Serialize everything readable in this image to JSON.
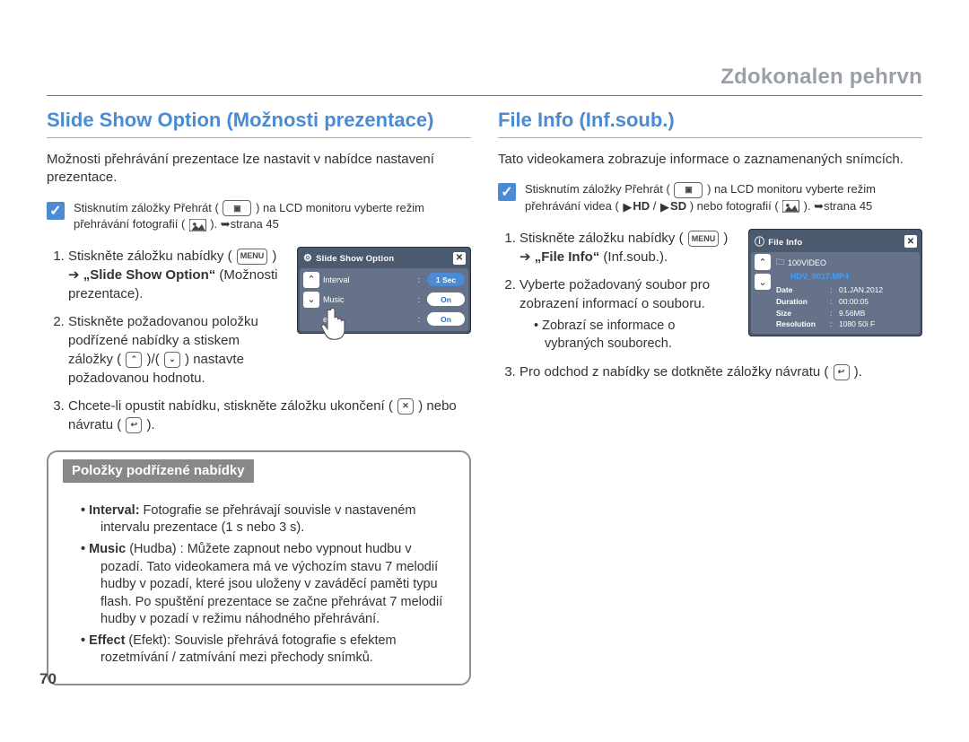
{
  "header": "Zdokonalen pehrvn",
  "page_number": "70",
  "left": {
    "title": "Slide Show Option (Možnosti prezentace)",
    "intro": "Možnosti přehrávání prezentace lze nastavit v nabídce nastavení prezentace.",
    "note_prefix": "Stisknutím záložky Přehrát (",
    "note_mid": ") na LCD monitoru vyberte režim přehrávání fotografií (",
    "note_suffix": "). ➥strana 45",
    "steps": {
      "s1a": "Stiskněte záložku nabídky (",
      "s1_label": " „Slide Show Option“",
      "s1_after": " (Možnosti prezentace).",
      "s2a": "Stiskněte požadovanou položku podřízené nabídky a stiskem záložky (",
      "s2_mid": ")/(",
      "s2b": ") nastavte požadovanou hodnotu.",
      "s3a": "Chcete-li opustit nabídku, stiskněte záložku ukončení (",
      "s3_mid": ") nebo návratu (",
      "s3b": ")."
    },
    "ui": {
      "title": "Slide Show Option",
      "rows": [
        {
          "k": "Interval",
          "v": "1 Sec",
          "sel": true
        },
        {
          "k": "Music",
          "v": "On"
        },
        {
          "k": "ect",
          "v": "On"
        }
      ]
    },
    "submenu_title": "Položky podřízené nabídky",
    "interval_label": "Interval:",
    "interval_text": " Fotografie se přehrávají souvisle v nastaveném intervalu prezentace (1 s nebo 3 s).",
    "music_label": "Music",
    "music_paren": " (Hudba) : ",
    "music_text": "Můžete zapnout nebo vypnout hudbu v pozadí. Tato videokamera má ve výchozím stavu 7 melodií hudby v pozadí, které jsou uloženy v zaváděcí paměti typu flash. Po spuštění prezentace se začne přehrávat 7 melodií hudby v pozadí v režimu náhodného přehrávání.",
    "effect_label": "Effect",
    "effect_paren": " (Efekt): ",
    "effect_text": "Souvisle přehrává fotografie s efektem rozetmívání / zatmívání mezi přechody snímků."
  },
  "right": {
    "title": "File Info (Inf.soub.)",
    "intro": "Tato videokamera zobrazuje informace o zaznamenaných snímcích.",
    "note_prefix": "Stisknutím záložky Přehrát (",
    "note_mid1": ") na LCD monitoru vyberte režim přehrávání videa (",
    "note_hd": "HD",
    "note_sd": "SD",
    "note_mid2": ") nebo fotografií (",
    "note_suffix": "). ➥strana 45",
    "steps": {
      "s1a": "Stiskněte záložku nabídky (",
      "s1_label": "„File Info“",
      "s1_after": " (Inf.soub.).",
      "s2a": "Vyberte požadovaný soubor pro zobrazení informací o souboru.",
      "s2_sub": "Zobrazí se informace o vybraných souborech.",
      "s3a": "Pro odchod z nabídky se dotkněte záložky návratu (",
      "s3b": ")."
    },
    "ui": {
      "title": "File Info",
      "folder": "100VIDEO",
      "filename": "HDV_0017.MP4",
      "rows": [
        {
          "k": "Date",
          "v": "01.JAN.2012"
        },
        {
          "k": "Duration",
          "v": "00:00:05"
        },
        {
          "k": "Size",
          "v": "9.56MB"
        },
        {
          "k": "Resolution",
          "v": "1080 50i F"
        }
      ]
    }
  }
}
